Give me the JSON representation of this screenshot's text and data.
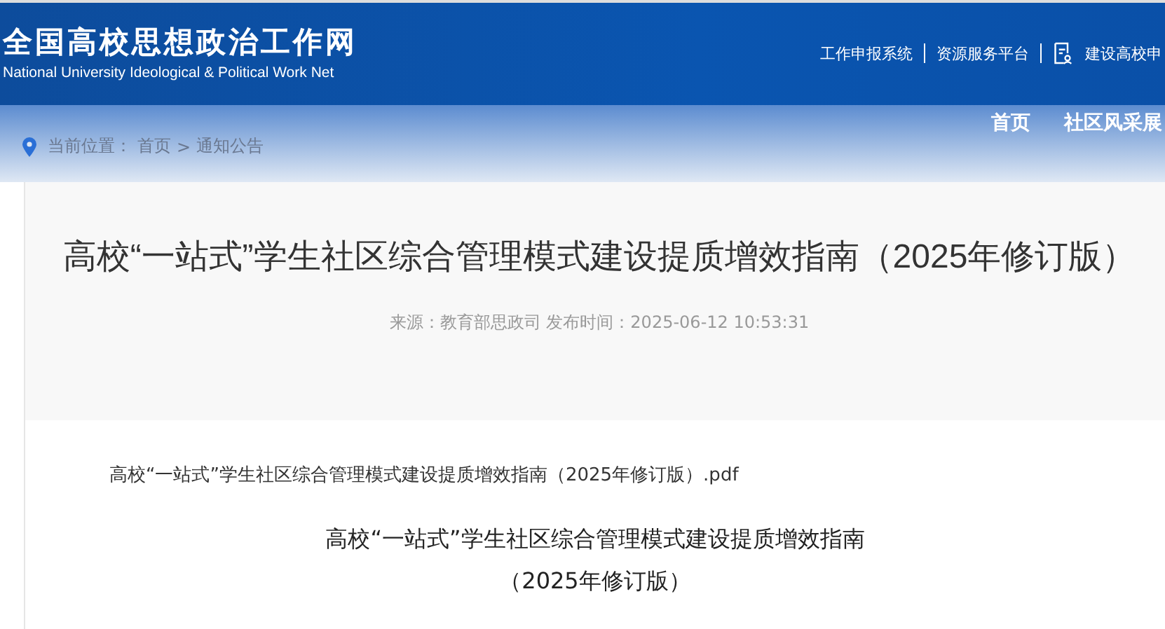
{
  "header": {
    "logo_title": "全国高校思想政治工作网",
    "logo_subtitle": "National University Ideological & Political Work Net",
    "links": [
      {
        "label": "工作申报系统",
        "kind": "text"
      },
      {
        "label": "资源服务平台",
        "kind": "text"
      },
      {
        "label": "建设高校申",
        "kind": "icon"
      }
    ]
  },
  "nav": [
    {
      "label": "首页"
    },
    {
      "label": "社区风采展"
    }
  ],
  "breadcrumb": {
    "prefix": "当前位置：",
    "items": [
      "首页",
      "通知公告"
    ],
    "separator": ">"
  },
  "article": {
    "title": "高校“一站式”学生社区综合管理模式建设提质增效指南（2025年修订版）",
    "meta": "来源：教育部思政司 发布时间：2025-06-12 10:53:31",
    "attachment": "高校“一站式”学生社区综合管理模式建设提质增效指南（2025年修订版）.pdf",
    "heading_lines": [
      "高校“一站式”学生社区综合管理模式建设提质增效指南",
      "（2025年修订版）"
    ]
  }
}
